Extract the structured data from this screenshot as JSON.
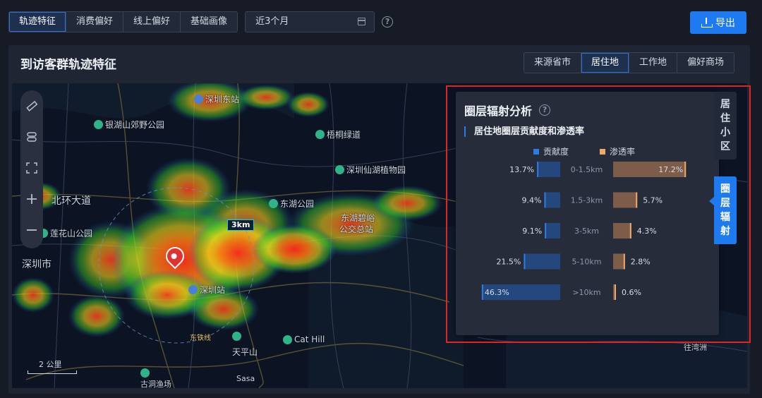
{
  "toolbar": {
    "tabs": [
      "轨迹特征",
      "消费偏好",
      "线上偏好",
      "基础画像"
    ],
    "active_tab": "轨迹特征",
    "date_range": "近3个月",
    "export_label": "导出"
  },
  "card": {
    "title": "到访客群轨迹特征",
    "subtabs": [
      "来源省市",
      "居住地",
      "工作地",
      "偏好商场"
    ],
    "active_subtab": "居住地"
  },
  "map": {
    "labels": [
      "深圳东站",
      "银湖山郊野公园",
      "梧桐绿道",
      "深圳仙湖植物园",
      "北环大道",
      "东湖公园",
      "东湖碧峪",
      "公交总站",
      "莲花山公园",
      "深圳市",
      "深圳站",
      "东铁线",
      "天平山",
      "Cat Hill",
      "Sasa",
      "古洞渔场",
      "往湾洲"
    ],
    "radius_label": "3km",
    "scale_label": "2 公里"
  },
  "panel": {
    "title": "圈层辐射分析",
    "subtitle": "居住地圈层贡献度和渗透率",
    "side_tabs": [
      "居住小区",
      "圈层辐射"
    ],
    "active_side_tab": "圈层辐射",
    "colors": {
      "contribution": "#2f7be6",
      "penetration": "#f0a868"
    }
  },
  "chart_data": {
    "type": "bar",
    "title": "居住地圈层贡献度和渗透率",
    "categories": [
      "0-1.5km",
      "1.5-3km",
      "3-5km",
      "5-10km",
      ">10km"
    ],
    "series": [
      {
        "name": "贡献度",
        "values": [
          13.7,
          9.4,
          9.1,
          21.5,
          46.3
        ],
        "labels": [
          "13.7%",
          "9.4%",
          "9.1%",
          "21.5%",
          "46.3%"
        ]
      },
      {
        "name": "渗透率",
        "values": [
          17.2,
          5.7,
          4.3,
          2.8,
          0.6
        ],
        "labels": [
          "17.2%",
          "5.7%",
          "4.3%",
          "2.8%",
          "0.6%"
        ]
      }
    ],
    "legend_position": "top"
  }
}
